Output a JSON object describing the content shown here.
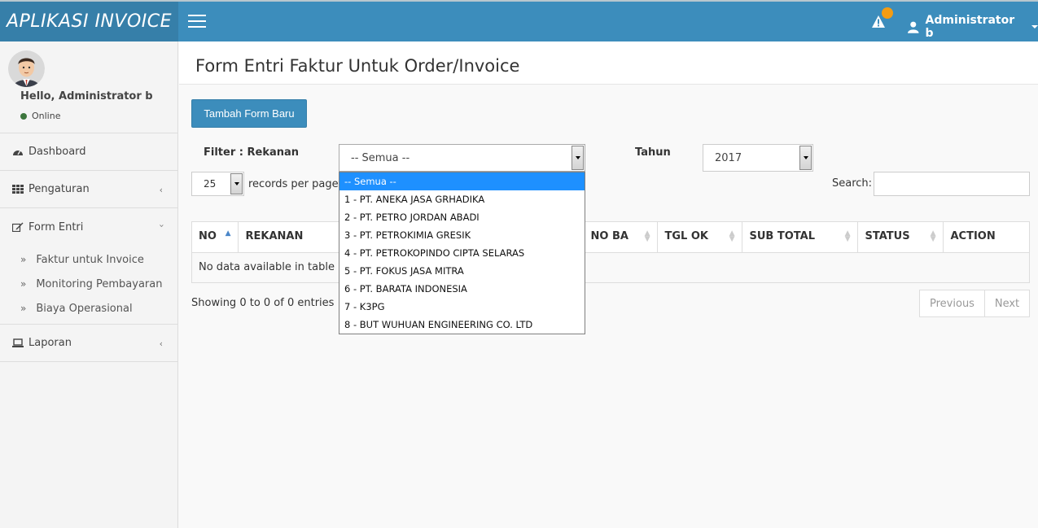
{
  "app": {
    "brand": "APLIKASI INVOICE"
  },
  "topbar": {
    "user_name": "Administrator b"
  },
  "sidebar": {
    "greeting": "Hello, Administrator b",
    "status": "Online",
    "items": [
      {
        "label": "Dashboard",
        "icon": "dashboard-icon"
      },
      {
        "label": "Pengaturan",
        "icon": "grid-icon"
      },
      {
        "label": "Form Entri",
        "icon": "edit-icon"
      },
      {
        "label": "Laporan",
        "icon": "laptop-icon"
      }
    ],
    "form_entri_sub": [
      "Faktur untuk Invoice",
      "Monitoring Pembayaran",
      "Biaya Operasional"
    ]
  },
  "page": {
    "title": "Form Entri Faktur Untuk Order/Invoice",
    "add_button": "Tambah Form Baru",
    "filter_label": "Filter : Rekanan",
    "filter_value": "-- Semua --",
    "year_label": "Tahun",
    "year_value": "2017"
  },
  "table_controls": {
    "page_length": "25",
    "records_per_page": "records per page",
    "search_label": "Search:"
  },
  "table": {
    "columns": [
      "NO",
      "REKANAN",
      "",
      "NO BA",
      "TGL OK",
      "SUB TOTAL",
      "STATUS",
      "ACTION"
    ],
    "empty_message": "No data available in table",
    "info": "Showing 0 to 0 of 0 entries",
    "prev": "Previous",
    "next": "Next"
  },
  "dropdown": {
    "options": [
      "-- Semua --",
      "1 - PT. ANEKA JASA GRHADIKA",
      "2 - PT. PETRO JORDAN ABADI",
      "3 - PT. PETROKIMIA GRESIK",
      "4 - PT. PETROKOPINDO CIPTA SELARAS",
      "5 - PT. FOKUS JASA MITRA",
      "6 - PT. BARATA INDONESIA",
      "7 - K3PG",
      "8 - BUT WUHUAN ENGINEERING CO. LTD"
    ],
    "selected_index": 0
  },
  "colors": {
    "header": "#3c8dbc",
    "brand_bg": "#367fa9",
    "badge": "#f39c12",
    "selected_option": "#1e90ff"
  }
}
